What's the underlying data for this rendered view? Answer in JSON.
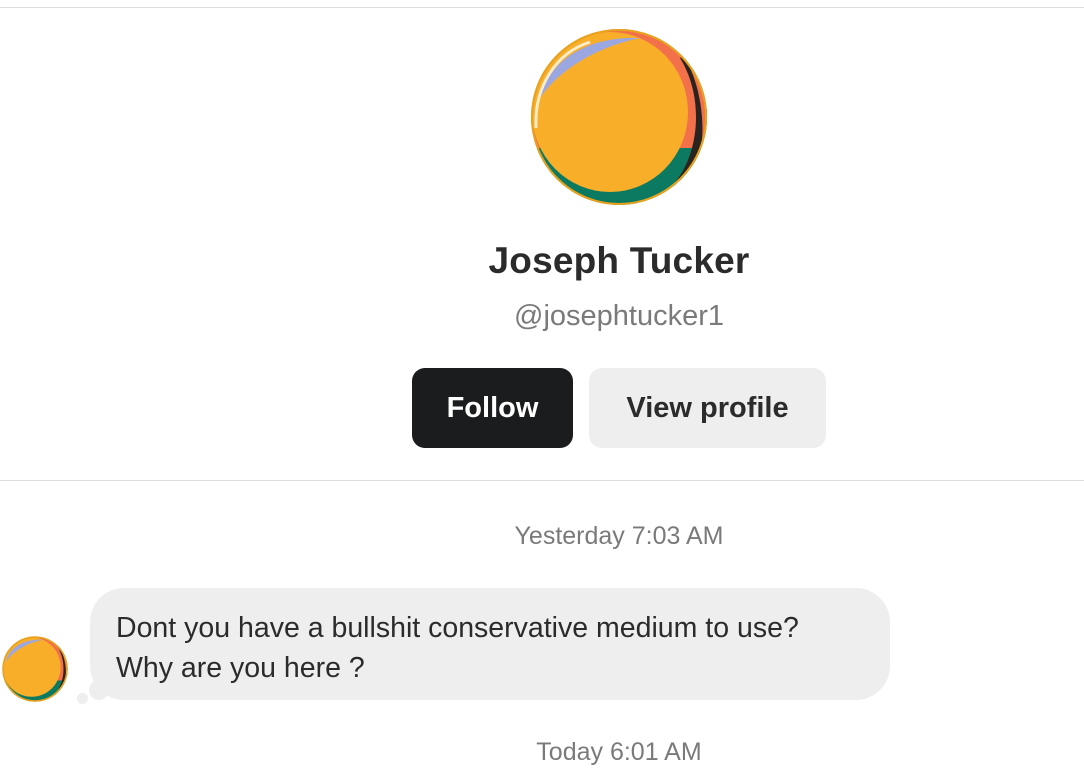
{
  "profile": {
    "name": "Joseph Tucker",
    "handle": "@josephtucker1",
    "avatar_icon": "orange-circle-avatar",
    "avatar_colors": {
      "main": "#f9ae2a",
      "rim": "#e8a21c",
      "accent_blue": "#9aa7e0",
      "accent_dark": "#2a231f",
      "accent_red": "#f2704a",
      "accent_green": "#0b7a60"
    }
  },
  "actions": {
    "follow_label": "Follow",
    "view_profile_label": "View profile"
  },
  "conversation": {
    "messages": [
      {
        "timestamp": "Yesterday 7:03 AM",
        "line1": "Dont you have a bullshit conservative medium to use?",
        "line2": "Why are you here ?"
      }
    ],
    "next_timestamp": "Today 6:01 AM"
  },
  "colors": {
    "follow_bg": "#1b1c1e",
    "secondary_bg": "#eeeeee",
    "bubble_bg": "#eeeeee",
    "muted_text": "#7a7a7a"
  }
}
